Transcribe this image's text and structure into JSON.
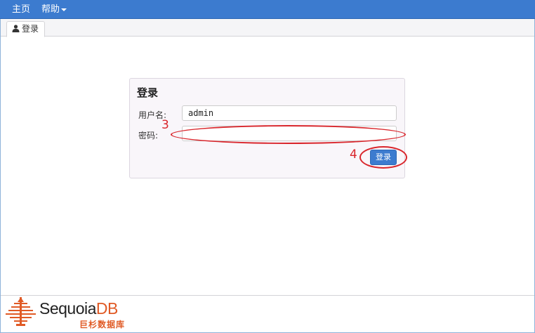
{
  "nav": {
    "home_label": "主页",
    "help_label": "帮助"
  },
  "tab": {
    "label": "登录",
    "icon": "user-icon"
  },
  "login_panel": {
    "title": "登录",
    "username_label": "用户名:",
    "username_value": "admin",
    "password_label": "密码:",
    "password_value": "",
    "submit_label": "登录"
  },
  "annotations": {
    "step_3": "3",
    "step_4": "4"
  },
  "footer": {
    "logo_text_main": "Sequoia",
    "logo_text_accent": "DB",
    "logo_subtitle": "巨杉数据库",
    "logo_icon": "sequoia-tree-logo"
  },
  "colors": {
    "navbar": "#3c7bcf",
    "panel_bg": "#f9f6fa",
    "button": "#3c7bcf",
    "annotation": "#d9262c",
    "brand_orange": "#e05a25"
  }
}
